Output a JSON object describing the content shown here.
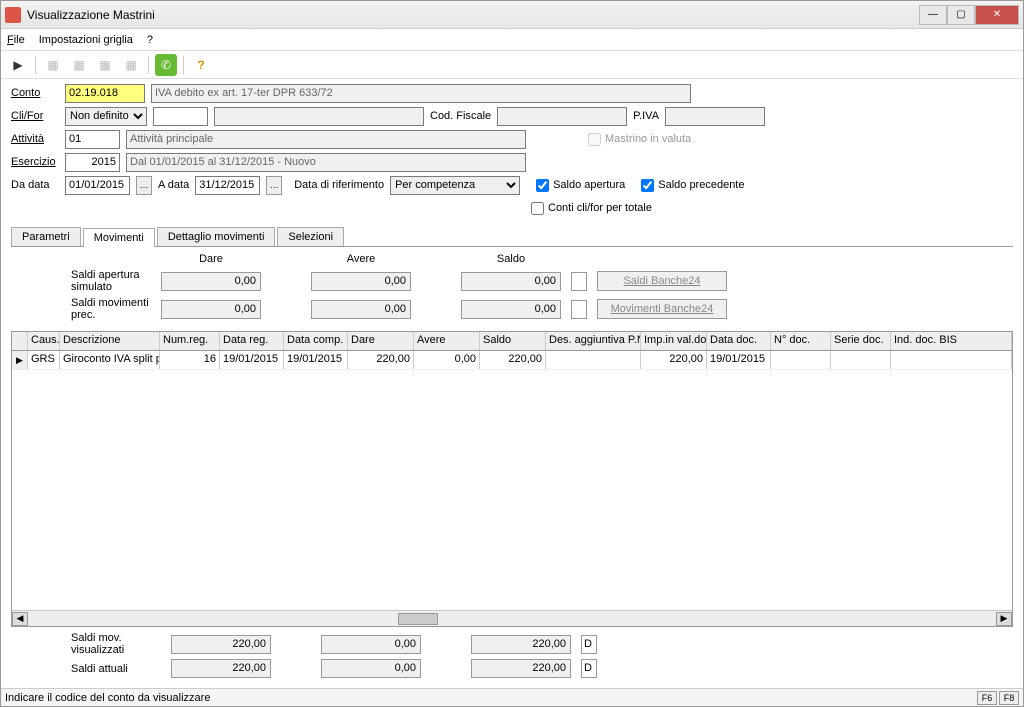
{
  "window": {
    "title": "Visualizzazione Mastrini"
  },
  "menu": {
    "file": "File",
    "impostazioni": "Impostazioni griglia",
    "help": "?"
  },
  "form": {
    "conto_label": "Conto",
    "conto_value": "02.19.018",
    "conto_desc": "IVA debito ex art. 17-ter DPR 633/72",
    "clifor_label": "Cli/For",
    "clifor_value": "Non definito",
    "codfiscale_label": "Cod. Fiscale",
    "piva_label": "P.IVA",
    "attivita_label": "Attività",
    "attivita_value": "01",
    "attivita_desc": "Attività principale",
    "mastrino_valuta": "Mastrino in valuta",
    "esercizio_label": "Esercizio",
    "esercizio_value": "2015",
    "esercizio_desc": "Dal 01/01/2015 al 31/12/2015 - Nuovo",
    "dadata_label": "Da data",
    "dadata_value": "01/01/2015",
    "adata_label": "A data",
    "adata_value": "31/12/2015",
    "datarif_label": "Data di riferimento",
    "datarif_value": "Per competenza",
    "saldo_apertura": "Saldo apertura",
    "saldo_precedente": "Saldo precedente",
    "conti_totale": "Conti cli/for per totale"
  },
  "tabs": {
    "parametri": "Parametri",
    "movimenti": "Movimenti",
    "dettaglio": "Dettaglio movimenti",
    "selezioni": "Selezioni"
  },
  "saldi": {
    "head_dare": "Dare",
    "head_avere": "Avere",
    "head_saldo": "Saldo",
    "apertura_label": "Saldi apertura simulato",
    "apertura_dare": "0,00",
    "apertura_avere": "0,00",
    "apertura_saldo": "0,00",
    "prec_label": "Saldi movimenti prec.",
    "prec_dare": "0,00",
    "prec_avere": "0,00",
    "prec_saldo": "0,00",
    "btn_saldi_banche": "Saldi Banche24",
    "btn_mov_banche": "Movimenti Banche24"
  },
  "grid": {
    "cols": {
      "caus": "Caus.",
      "descr": "Descrizione",
      "numreg": "Num.reg.",
      "datareg": "Data reg.",
      "datacomp": "Data comp.",
      "dare": "Dare",
      "avere": "Avere",
      "saldo": "Saldo",
      "desagg": "Des. aggiuntiva P.N",
      "impval": "Imp.in val.do",
      "datadoc": "Data doc.",
      "numdoc": "N° doc.",
      "seriedoc": "Serie doc.",
      "inddoc": "Ind. doc. BIS"
    },
    "row": {
      "caus": "GRS",
      "descr": "Giroconto IVA split p",
      "numreg": "16",
      "datareg": "19/01/2015",
      "datacomp": "19/01/2015",
      "dare": "220,00",
      "avere": "0,00",
      "saldo": "220,00",
      "desagg": "",
      "impval": "220,00",
      "datadoc": "19/01/2015",
      "numdoc": "",
      "seriedoc": "",
      "inddoc": ""
    }
  },
  "bottom": {
    "vis_label": "Saldi mov. visualizzati",
    "vis_dare": "220,00",
    "vis_avere": "0,00",
    "vis_saldo": "220,00",
    "vis_d": "D",
    "att_label": "Saldi attuali",
    "att_dare": "220,00",
    "att_avere": "0,00",
    "att_saldo": "220,00",
    "att_d": "D"
  },
  "status": {
    "text": "Indicare il codice del conto da visualizzare",
    "f6": "F6",
    "f8": "F8"
  }
}
